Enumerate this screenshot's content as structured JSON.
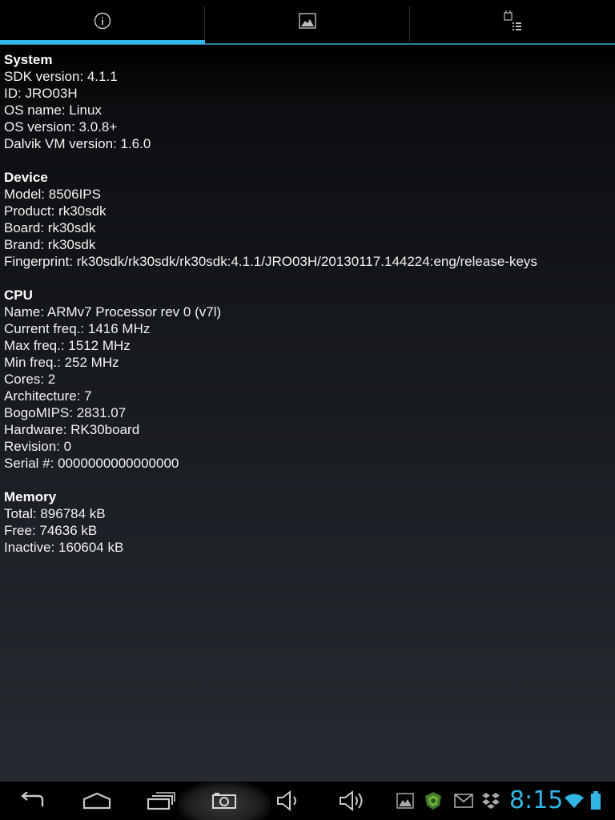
{
  "tabs": [
    {
      "label": "",
      "icon": "info-icon",
      "selected": true
    },
    {
      "label": "",
      "icon": "image-icon",
      "selected": false
    },
    {
      "label": "",
      "icon": "app-list-icon",
      "selected": false
    }
  ],
  "sections": [
    {
      "title": "System",
      "lines": [
        "SDK version: 4.1.1",
        "ID: JRO03H",
        "OS name: Linux",
        "OS version: 3.0.8+",
        "Dalvik VM version: 1.6.0"
      ]
    },
    {
      "title": "Device",
      "lines": [
        "Model: 8506IPS",
        "Product: rk30sdk",
        "Board: rk30sdk",
        "Brand: rk30sdk",
        "Fingerprint: rk30sdk/rk30sdk/rk30sdk:4.1.1/JRO03H/20130117.144224:eng/release-keys"
      ]
    },
    {
      "title": "CPU",
      "lines": [
        "Name: ARMv7 Processor rev 0 (v7l)",
        "Current freq.: 1416 MHz",
        "Max freq.: 1512 MHz",
        "Min freq.: 252 MHz",
        "Cores: 2",
        "Architecture: 7",
        "BogoMIPS: 2831.07",
        "Hardware: RK30board",
        "Revision: 0",
        "Serial #: 0000000000000000"
      ]
    },
    {
      "title": "Memory",
      "lines": [
        "Total: 896784 kB",
        "Free: 74636 kB",
        "Inactive: 160604 kB"
      ]
    }
  ],
  "navbar": {
    "buttons": [
      "back-icon",
      "home-icon",
      "recent-apps-icon",
      "screenshot-camera-icon",
      "volume-down-icon",
      "volume-up-icon"
    ]
  },
  "statusbar": {
    "clock": "8:15",
    "icons": [
      "gallery-notification-icon",
      "shield-app-icon",
      "gmail-icon",
      "dropbox-icon",
      "wifi-icon",
      "battery-icon"
    ]
  },
  "colors": {
    "accent": "#33b5e5",
    "background": "#000000",
    "text": "#ffffff"
  }
}
